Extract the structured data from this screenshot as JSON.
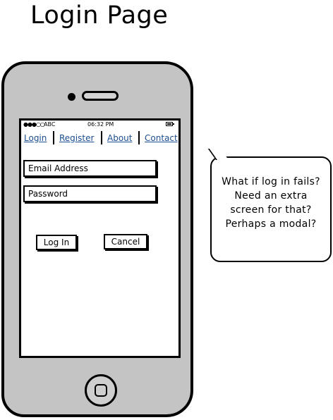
{
  "page": {
    "title": "Login Page"
  },
  "statusbar": {
    "signal": "●●●○○",
    "carrier": "ABC",
    "time": "06:32 PM"
  },
  "nav": {
    "items": [
      {
        "label": "Login"
      },
      {
        "label": "Register"
      },
      {
        "label": "About"
      },
      {
        "label": "Contact"
      }
    ]
  },
  "form": {
    "email_label": "Email Address",
    "password_label": "Password",
    "login_button": "Log In",
    "cancel_button": "Cancel"
  },
  "note": {
    "text": "What if log in fails?  Need an extra screen for that?  Perhaps a modal?"
  },
  "colors": {
    "link": "#1a4d8f",
    "phone_body": "#c4c4c4"
  }
}
